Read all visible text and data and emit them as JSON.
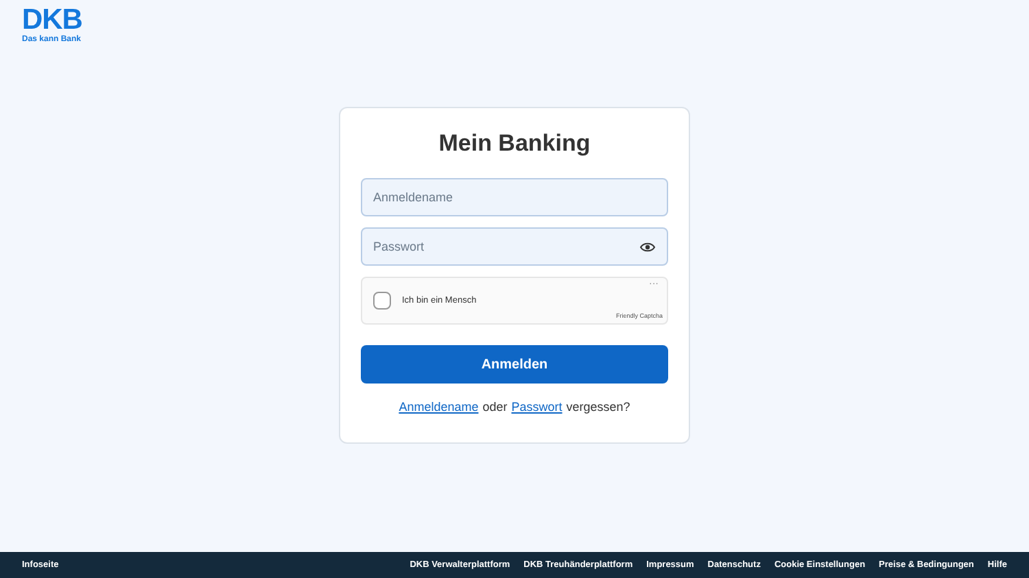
{
  "logo": {
    "name": "DKB",
    "tagline": "Das kann Bank"
  },
  "login": {
    "title": "Mein Banking",
    "username": {
      "placeholder": "Anmeldename"
    },
    "password": {
      "placeholder": "Passwort"
    },
    "captcha": {
      "label": "Ich bin ein Mensch",
      "menu": "···",
      "provider": "Friendly Captcha",
      "checked": false
    },
    "submit": "Anmelden",
    "help": [
      {
        "kind": "link",
        "text": "Anmeldename"
      },
      {
        "kind": "text",
        "text": "oder"
      },
      {
        "kind": "link",
        "text": "Passwort"
      },
      {
        "kind": "text",
        "text": "vergessen?"
      }
    ]
  },
  "footer": {
    "left": "Infoseite",
    "links": [
      "DKB Verwalterplattform",
      "DKB Treuhänderplattform",
      "Impressum",
      "Datenschutz",
      "Cookie Einstellungen",
      "Preise & Bedingungen",
      "Hilfe"
    ]
  }
}
